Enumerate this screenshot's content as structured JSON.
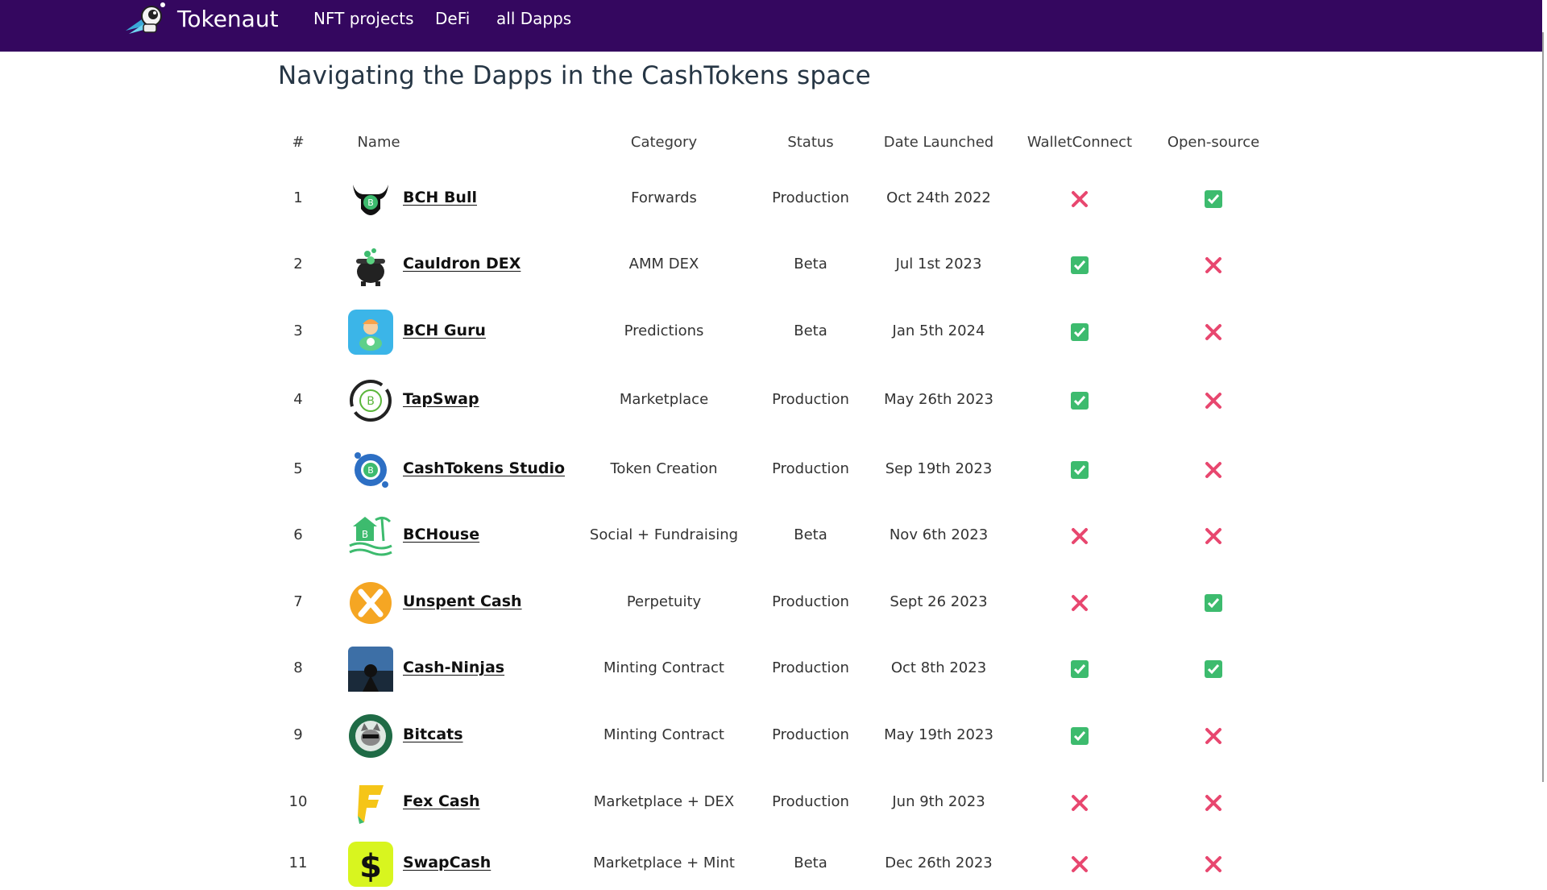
{
  "nav": {
    "brand": "Tokenaut",
    "links": [
      "NFT projects",
      "DeFi",
      "all Dapps"
    ]
  },
  "page_title": "Navigating the Dapps in the CashTokens space",
  "table": {
    "headers": [
      "#",
      "Name",
      "Category",
      "Status",
      "Date Launched",
      "WalletConnect",
      "Open-source"
    ],
    "rows": [
      {
        "num": "1",
        "name": "BCH Bull",
        "icon": "bull-logo-icon",
        "category": "Forwards",
        "status": "Production",
        "date": "Oct 24th 2022",
        "walletconnect": false,
        "opensource": true
      },
      {
        "num": "2",
        "name": "Cauldron DEX",
        "icon": "cauldron-logo-icon",
        "category": "AMM DEX",
        "status": "Beta",
        "date": "Jul 1st 2023",
        "walletconnect": true,
        "opensource": false
      },
      {
        "num": "3",
        "name": "BCH Guru",
        "icon": "guru-logo-icon",
        "category": "Predictions",
        "status": "Beta",
        "date": "Jan 5th 2024",
        "walletconnect": true,
        "opensource": false
      },
      {
        "num": "4",
        "name": "TapSwap",
        "icon": "tapswap-logo-icon",
        "category": "Marketplace",
        "status": "Production",
        "date": "May 26th 2023",
        "walletconnect": true,
        "opensource": false
      },
      {
        "num": "5",
        "name": "CashTokens Studio",
        "icon": "studio-logo-icon",
        "category": "Token Creation",
        "status": "Production",
        "date": "Sep 19th 2023",
        "walletconnect": true,
        "opensource": false
      },
      {
        "num": "6",
        "name": "BCHouse",
        "icon": "bchouse-logo-icon",
        "category": "Social + Fundraising",
        "status": "Beta",
        "date": "Nov 6th 2023",
        "walletconnect": false,
        "opensource": false
      },
      {
        "num": "7",
        "name": "Unspent Cash",
        "icon": "unspent-logo-icon",
        "category": "Perpetuity",
        "status": "Production",
        "date": "Sept 26 2023",
        "walletconnect": false,
        "opensource": true
      },
      {
        "num": "8",
        "name": "Cash-Ninjas",
        "icon": "ninjas-logo-icon",
        "category": "Minting Contract",
        "status": "Production",
        "date": "Oct 8th 2023",
        "walletconnect": true,
        "opensource": true
      },
      {
        "num": "9",
        "name": "Bitcats",
        "icon": "bitcats-logo-icon",
        "category": "Minting Contract",
        "status": "Production",
        "date": "May 19th 2023",
        "walletconnect": true,
        "opensource": false
      },
      {
        "num": "10",
        "name": "Fex Cash",
        "icon": "fexcash-logo-icon",
        "category": "Marketplace + DEX",
        "status": "Production",
        "date": "Jun 9th 2023",
        "walletconnect": false,
        "opensource": false
      },
      {
        "num": "11",
        "name": "SwapCash",
        "icon": "swapcash-logo-icon",
        "category": "Marketplace + Mint",
        "status": "Beta",
        "date": "Dec 26th 2023",
        "walletconnect": false,
        "opensource": false
      }
    ]
  },
  "colors": {
    "nav_bg": "#34075f",
    "check": "#3dbb6e",
    "cross": "#e8476f"
  }
}
